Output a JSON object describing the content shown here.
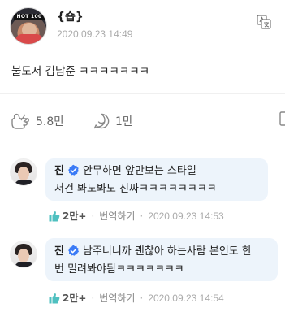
{
  "post": {
    "author": "{숍}",
    "time": "2020.09.23 14:49",
    "text": "불도저 김남준 ㅋㅋㅋㅋㅋㅋㅋ",
    "avatar_label": "HOT 100"
  },
  "actions": {
    "likes": "5.8만",
    "comments": "1만"
  },
  "comments": [
    {
      "name": "진",
      "line1": "안무하면 앞만보는 스타일",
      "line2": "저건 봐도봐도 진짜ㅋㅋㅋㅋㅋㅋㅋㅋ",
      "likes": "2만+",
      "translate": "번역하기",
      "time": "2020.09.23 14:53"
    },
    {
      "name": "진",
      "line1": "남주니니까 괜찮아 하는사람 본인도 한",
      "line2": "번 밀려봐야됨ㅋㅋㅋㅋㅋㅋㅋ",
      "likes": "2만+",
      "translate": "번역하기",
      "time": "2020.09.23 14:54"
    }
  ],
  "colors": {
    "accent": "#4fc0c0",
    "verified": "#3b7bf6",
    "bubble": "#edf4fb"
  },
  "icons": [
    "translate-icon",
    "like-icon",
    "comment-icon",
    "thumbs-up-icon",
    "verified-badge-icon"
  ]
}
